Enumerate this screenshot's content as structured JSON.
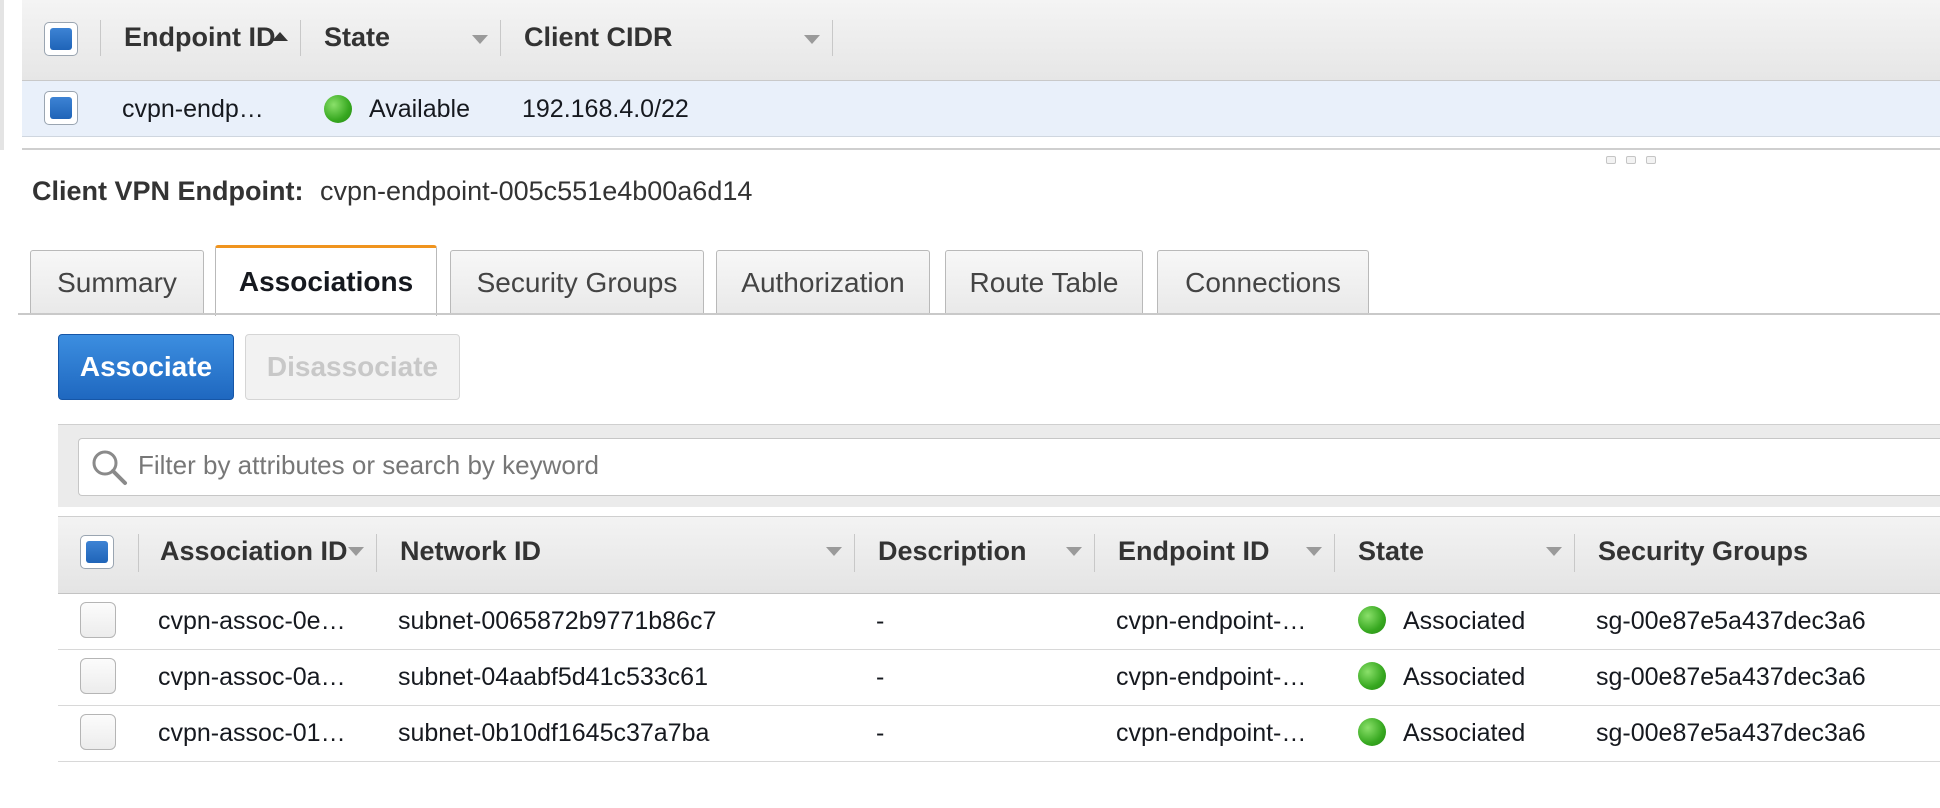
{
  "endpoints_table": {
    "columns": {
      "endpoint_id": "Endpoint ID",
      "state": "State",
      "client_cidr": "Client CIDR"
    },
    "row": {
      "endpoint_id": "cvpn-endp…",
      "state": "Available",
      "client_cidr": "192.168.4.0/22"
    }
  },
  "detail": {
    "label": "Client VPN Endpoint:",
    "value": "cvpn-endpoint-005c551e4b00a6d14"
  },
  "tabs": {
    "summary": "Summary",
    "associations": "Associations",
    "security_groups": "Security Groups",
    "authorization": "Authorization",
    "route_table": "Route Table",
    "connections": "Connections"
  },
  "active_tab": "Associations",
  "toolbar": {
    "associate": "Associate",
    "disassociate": "Disassociate"
  },
  "filter": {
    "placeholder": "Filter by attributes or search by keyword"
  },
  "associations_table": {
    "columns": {
      "association_id": "Association ID",
      "network_id": "Network ID",
      "description": "Description",
      "endpoint_id": "Endpoint ID",
      "state": "State",
      "security_groups": "Security Groups"
    },
    "rows": [
      {
        "association_id": "cvpn-assoc-0e…",
        "network_id": "subnet-0065872b9771b86c7",
        "description": "-",
        "endpoint_id": "cvpn-endpoint-…",
        "state": "Associated",
        "security_groups": "sg-00e87e5a437dec3a6"
      },
      {
        "association_id": "cvpn-assoc-0a…",
        "network_id": "subnet-04aabf5d41c533c61",
        "description": "-",
        "endpoint_id": "cvpn-endpoint-…",
        "state": "Associated",
        "security_groups": "sg-00e87e5a437dec3a6"
      },
      {
        "association_id": "cvpn-assoc-01…",
        "network_id": "subnet-0b10df1645c37a7ba",
        "description": "-",
        "endpoint_id": "cvpn-endpoint-…",
        "state": "Associated",
        "security_groups": "sg-00e87e5a437dec3a6"
      }
    ]
  },
  "colors": {
    "primary_button": "#1f68c0",
    "active_tab_accent": "#f0941e",
    "selected_row": "#e9f0fa",
    "status_green": "#37a820"
  }
}
